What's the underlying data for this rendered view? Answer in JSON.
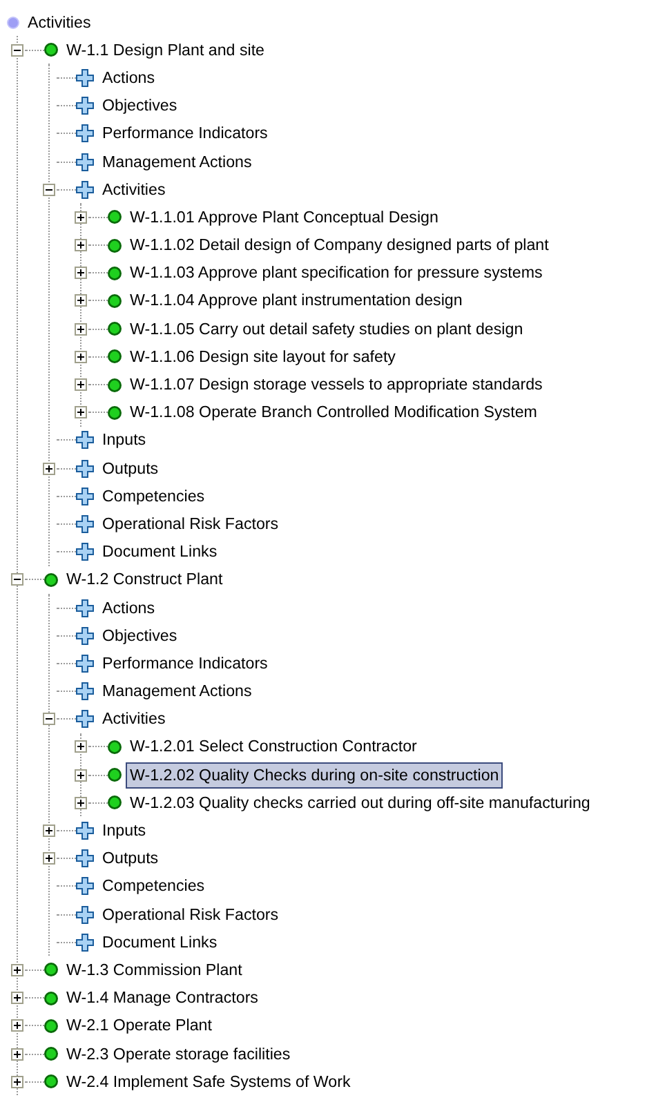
{
  "tree": {
    "items": [
      {
        "label": "Activities",
        "kind": "root",
        "selected": false,
        "children": [
          {
            "label": "W-1.1 Design Plant and site",
            "kind": "activity",
            "expanded": true,
            "selected": false,
            "children": [
              {
                "label": "Actions",
                "kind": "folder",
                "selected": false
              },
              {
                "label": "Objectives",
                "kind": "folder",
                "selected": false
              },
              {
                "label": "Performance Indicators",
                "kind": "folder",
                "selected": false
              },
              {
                "label": "Management Actions",
                "kind": "folder",
                "selected": false
              },
              {
                "label": "Activities",
                "kind": "folder",
                "expanded": true,
                "selected": false,
                "children": [
                  {
                    "label": "W-1.1.01 Approve Plant Conceptual Design",
                    "kind": "activity",
                    "expanded": false,
                    "selected": false
                  },
                  {
                    "label": "W-1.1.02 Detail design of Company designed parts of plant",
                    "kind": "activity",
                    "expanded": false,
                    "selected": false
                  },
                  {
                    "label": "W-1.1.03 Approve plant specification for pressure systems",
                    "kind": "activity",
                    "expanded": false,
                    "selected": false
                  },
                  {
                    "label": "W-1.1.04 Approve plant instrumentation design",
                    "kind": "activity",
                    "expanded": false,
                    "selected": false
                  },
                  {
                    "label": "W-1.1.05 Carry out detail safety studies on plant design",
                    "kind": "activity",
                    "expanded": false,
                    "selected": false
                  },
                  {
                    "label": "W-1.1.06 Design site layout for safety",
                    "kind": "activity",
                    "expanded": false,
                    "selected": false
                  },
                  {
                    "label": "W-1.1.07 Design storage vessels to appropriate standards",
                    "kind": "activity",
                    "expanded": false,
                    "selected": false
                  },
                  {
                    "label": "W-1.1.08 Operate Branch Controlled Modification System",
                    "kind": "activity",
                    "expanded": false,
                    "selected": false
                  }
                ]
              },
              {
                "label": "Inputs",
                "kind": "folder",
                "selected": false
              },
              {
                "label": "Outputs",
                "kind": "folder",
                "expanded": false,
                "selected": false
              },
              {
                "label": "Competencies",
                "kind": "folder",
                "selected": false
              },
              {
                "label": "Operational Risk Factors",
                "kind": "folder",
                "selected": false
              },
              {
                "label": "Document Links",
                "kind": "folder",
                "selected": false
              }
            ]
          },
          {
            "label": "W-1.2 Construct Plant",
            "kind": "activity",
            "expanded": true,
            "selected": false,
            "children": [
              {
                "label": "Actions",
                "kind": "folder",
                "selected": false
              },
              {
                "label": "Objectives",
                "kind": "folder",
                "selected": false
              },
              {
                "label": "Performance Indicators",
                "kind": "folder",
                "selected": false
              },
              {
                "label": "Management Actions",
                "kind": "folder",
                "selected": false
              },
              {
                "label": "Activities",
                "kind": "folder",
                "expanded": true,
                "selected": false,
                "children": [
                  {
                    "label": "W-1.2.01 Select Construction Contractor",
                    "kind": "activity",
                    "expanded": false,
                    "selected": false
                  },
                  {
                    "label": "W-1.2.02 Quality Checks during on-site construction",
                    "kind": "activity",
                    "expanded": false,
                    "selected": true
                  },
                  {
                    "label": "W-1.2.03 Quality checks carried out during off-site manufacturing",
                    "kind": "activity",
                    "expanded": false,
                    "selected": false
                  }
                ]
              },
              {
                "label": "Inputs",
                "kind": "folder",
                "expanded": false,
                "selected": false
              },
              {
                "label": "Outputs",
                "kind": "folder",
                "expanded": false,
                "selected": false
              },
              {
                "label": "Competencies",
                "kind": "folder",
                "selected": false
              },
              {
                "label": "Operational Risk Factors",
                "kind": "folder",
                "selected": false
              },
              {
                "label": "Document Links",
                "kind": "folder",
                "selected": false
              }
            ]
          },
          {
            "label": "W-1.3 Commission Plant",
            "kind": "activity",
            "expanded": false,
            "selected": false
          },
          {
            "label": "W-1.4 Manage Contractors",
            "kind": "activity",
            "expanded": false,
            "selected": false
          },
          {
            "label": "W-2.1 Operate Plant",
            "kind": "activity",
            "expanded": false,
            "selected": false
          },
          {
            "label": "W-2.3 Operate storage facilities",
            "kind": "activity",
            "expanded": false,
            "selected": false
          },
          {
            "label": "W-2.4 Implement Safe Systems of Work",
            "kind": "activity",
            "expanded": false,
            "selected": false
          }
        ]
      }
    ]
  }
}
